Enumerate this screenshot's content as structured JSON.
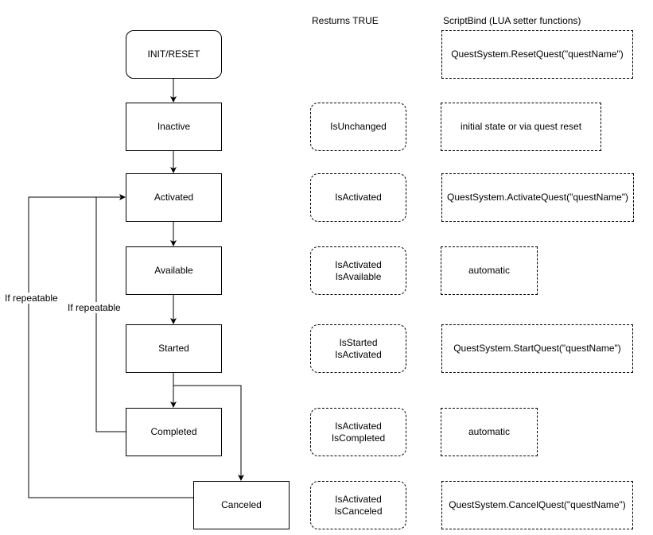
{
  "headers": {
    "returns_true": "Resturns TRUE",
    "script_bind": "ScriptBind (LUA setter functions)"
  },
  "states": [
    {
      "id": "init",
      "label": "INIT/RESET"
    },
    {
      "id": "inactive",
      "label": "Inactive"
    },
    {
      "id": "activated",
      "label": "Activated"
    },
    {
      "id": "available",
      "label": "Available"
    },
    {
      "id": "started",
      "label": "Started"
    },
    {
      "id": "completed",
      "label": "Completed"
    },
    {
      "id": "canceled",
      "label": "Canceled"
    }
  ],
  "returns": [
    {
      "state": "inactive",
      "text": "IsUnchanged"
    },
    {
      "state": "activated",
      "text": "IsActivated"
    },
    {
      "state": "available",
      "text": "IsActivated\nIsAvailable"
    },
    {
      "state": "started",
      "text": "IsStarted\nIsActivated"
    },
    {
      "state": "completed",
      "text": "IsActivated\nIsCompleted"
    },
    {
      "state": "canceled",
      "text": "IsActivated\nIsCanceled"
    }
  ],
  "script_bind": [
    {
      "state": "init",
      "text": "QuestSystem.ResetQuest(\"questName\")"
    },
    {
      "state": "inactive",
      "text": "initial state or via quest reset"
    },
    {
      "state": "activated",
      "text": "QuestSystem.ActivateQuest(\"questName\")"
    },
    {
      "state": "available",
      "text": "automatic"
    },
    {
      "state": "started",
      "text": "QuestSystem.StartQuest(\"questName\")"
    },
    {
      "state": "completed",
      "text": "automatic"
    },
    {
      "state": "canceled",
      "text": "QuestSystem.CancelQuest(\"questName\")"
    }
  ],
  "edges": [
    {
      "from": "init",
      "to": "inactive"
    },
    {
      "from": "inactive",
      "to": "activated"
    },
    {
      "from": "activated",
      "to": "available"
    },
    {
      "from": "available",
      "to": "started"
    },
    {
      "from": "started",
      "to": "completed"
    },
    {
      "from": "started",
      "to": "canceled"
    },
    {
      "from": "completed",
      "to": "activated",
      "label": "If repeatable"
    },
    {
      "from": "canceled",
      "to": "activated",
      "label": "If repeatable"
    }
  ],
  "edge_labels": {
    "completed_loop": "If repeatable",
    "canceled_loop": "If repeatable"
  }
}
